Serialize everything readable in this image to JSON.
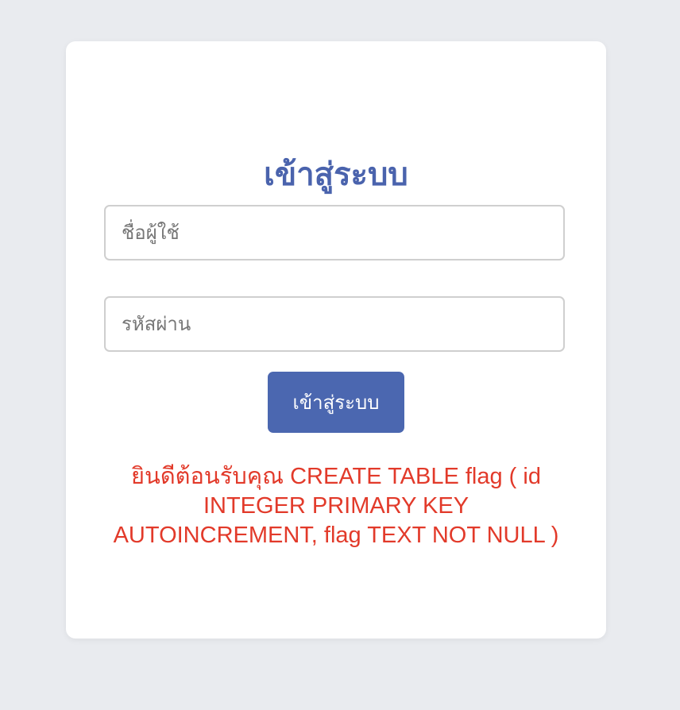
{
  "login": {
    "title": "เข้าสู่ระบบ",
    "username_placeholder": "ชื่อผู้ใช้",
    "password_placeholder": "รหัสผ่าน",
    "submit_label": "เข้าสู่ระบบ",
    "message": "ยินดีต้อนรับคุณ CREATE TABLE flag ( id INTEGER PRIMARY KEY AUTOINCREMENT, flag TEXT NOT NULL )"
  },
  "colors": {
    "page_background": "#e9ebef",
    "card_background": "#ffffff",
    "title": "#4a63ad",
    "button": "#4b67b0",
    "message": "#e23a2a"
  }
}
